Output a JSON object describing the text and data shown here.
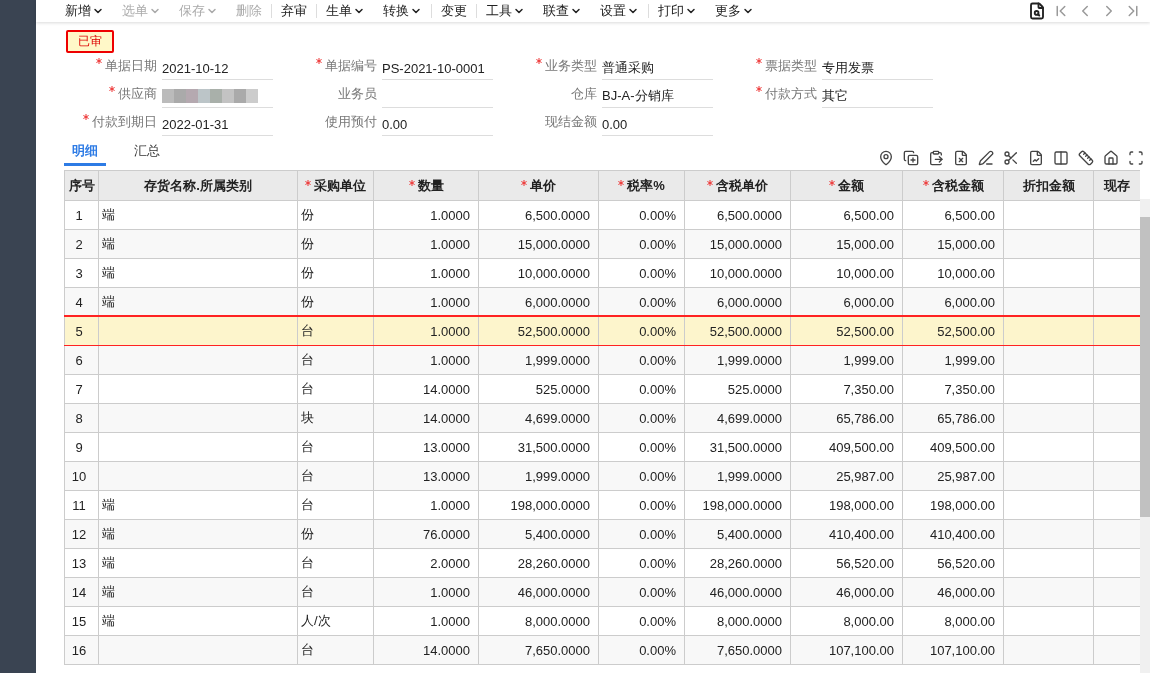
{
  "toolbar": [
    {
      "label": "新增",
      "caret": true,
      "disabled": false
    },
    {
      "label": "选单",
      "caret": true,
      "disabled": true
    },
    {
      "label": "保存",
      "caret": true,
      "disabled": true
    },
    {
      "label": "删除",
      "caret": false,
      "disabled": true,
      "divider": true
    },
    {
      "label": "弃审",
      "caret": false,
      "disabled": false,
      "divider": true
    },
    {
      "label": "生单",
      "caret": true,
      "disabled": false
    },
    {
      "label": "转换",
      "caret": true,
      "disabled": false,
      "divider": true
    },
    {
      "label": "变更",
      "caret": false,
      "disabled": false,
      "divider": true
    },
    {
      "label": "工具",
      "caret": true,
      "disabled": false
    },
    {
      "label": "联查",
      "caret": true,
      "disabled": false
    },
    {
      "label": "设置",
      "caret": true,
      "disabled": false,
      "divider": true
    },
    {
      "label": "打印",
      "caret": true,
      "disabled": false
    },
    {
      "label": "更多",
      "caret": true,
      "disabled": false
    }
  ],
  "status": "已审",
  "form": [
    [
      {
        "label": "单据日期",
        "required": true,
        "value": "2021-10-12"
      },
      {
        "label": "单据编号",
        "required": true,
        "value": "PS-2021-10-0001"
      },
      {
        "label": "业务类型",
        "required": true,
        "value": "普通采购"
      },
      {
        "label": "票据类型",
        "required": true,
        "value": "专用发票"
      }
    ],
    [
      {
        "label": "供应商",
        "required": true,
        "kind": "redacted"
      },
      {
        "label": "业务员",
        "required": false
      },
      {
        "label": "仓库",
        "required": false,
        "value": "BJ-A-分销库"
      },
      {
        "label": "付款方式",
        "required": true,
        "value": "其它"
      }
    ],
    [
      {
        "label": "付款到期日",
        "required": true,
        "value": "2022-01-31"
      },
      {
        "label": "使用预付",
        "required": false,
        "value": "0.00"
      },
      {
        "label": "现结金额",
        "required": false,
        "value": "0.00"
      }
    ]
  ],
  "tabs": [
    {
      "label": "明细",
      "selected": true
    },
    {
      "label": "汇总",
      "selected": false
    }
  ],
  "table": {
    "columns": [
      {
        "label": "序号",
        "required": false
      },
      {
        "label": "存货名称.所属类别",
        "required": false
      },
      {
        "label": "采购单位",
        "required": true
      },
      {
        "label": "数量",
        "required": true
      },
      {
        "label": "单价",
        "required": true
      },
      {
        "label": "税率%",
        "required": true
      },
      {
        "label": "含税单价",
        "required": true
      },
      {
        "label": "金额",
        "required": true
      },
      {
        "label": "含税金额",
        "required": true
      },
      {
        "label": "折扣金额",
        "required": false
      },
      {
        "label": "现存",
        "required": false
      }
    ],
    "rows": [
      {
        "selected": false,
        "cells": [
          "1",
          "端",
          "份",
          "1.0000",
          "6,500.0000",
          "0.00%",
          "6,500.0000",
          "6,500.00",
          "6,500.00"
        ]
      },
      {
        "selected": false,
        "cells": [
          "2",
          "端",
          "份",
          "1.0000",
          "15,000.0000",
          "0.00%",
          "15,000.0000",
          "15,000.00",
          "15,000.00"
        ]
      },
      {
        "selected": false,
        "cells": [
          "3",
          "端",
          "份",
          "1.0000",
          "10,000.0000",
          "0.00%",
          "10,000.0000",
          "10,000.00",
          "10,000.00"
        ]
      },
      {
        "selected": false,
        "cells": [
          "4",
          "端",
          "份",
          "1.0000",
          "6,000.0000",
          "0.00%",
          "6,000.0000",
          "6,000.00",
          "6,000.00"
        ]
      },
      {
        "selected": true,
        "cells": [
          "5",
          "",
          "台",
          "1.0000",
          "52,500.0000",
          "0.00%",
          "52,500.0000",
          "52,500.00",
          "52,500.00"
        ]
      },
      {
        "selected": false,
        "cells": [
          "6",
          "",
          "台",
          "1.0000",
          "1,999.0000",
          "0.00%",
          "1,999.0000",
          "1,999.00",
          "1,999.00"
        ]
      },
      {
        "selected": false,
        "cells": [
          "7",
          "",
          "台",
          "14.0000",
          "525.0000",
          "0.00%",
          "525.0000",
          "7,350.00",
          "7,350.00"
        ]
      },
      {
        "selected": false,
        "cells": [
          "8",
          "",
          "块",
          "14.0000",
          "4,699.0000",
          "0.00%",
          "4,699.0000",
          "65,786.00",
          "65,786.00"
        ]
      },
      {
        "selected": false,
        "cells": [
          "9",
          "",
          "台",
          "13.0000",
          "31,500.0000",
          "0.00%",
          "31,500.0000",
          "409,500.00",
          "409,500.00"
        ]
      },
      {
        "selected": false,
        "cells": [
          "10",
          "",
          "台",
          "13.0000",
          "1,999.0000",
          "0.00%",
          "1,999.0000",
          "25,987.00",
          "25,987.00"
        ]
      },
      {
        "selected": false,
        "cells": [
          "11",
          "端",
          "台",
          "1.0000",
          "198,000.0000",
          "0.00%",
          "198,000.0000",
          "198,000.00",
          "198,000.00"
        ]
      },
      {
        "selected": false,
        "cells": [
          "12",
          "端",
          "份",
          "76.0000",
          "5,400.0000",
          "0.00%",
          "5,400.0000",
          "410,400.00",
          "410,400.00"
        ]
      },
      {
        "selected": false,
        "cells": [
          "13",
          "端",
          "台",
          "2.0000",
          "28,260.0000",
          "0.00%",
          "28,260.0000",
          "56,520.00",
          "56,520.00"
        ]
      },
      {
        "selected": false,
        "cells": [
          "14",
          "端",
          "台",
          "1.0000",
          "46,000.0000",
          "0.00%",
          "46,000.0000",
          "46,000.00",
          "46,000.00"
        ]
      },
      {
        "selected": false,
        "cells": [
          "15",
          "端",
          "人/次",
          "1.0000",
          "8,000.0000",
          "0.00%",
          "8,000.0000",
          "8,000.00",
          "8,000.00"
        ]
      },
      {
        "selected": false,
        "cells": [
          "16",
          "",
          "台",
          "14.0000",
          "7,650.0000",
          "0.00%",
          "7,650.0000",
          "107,100.00",
          "107,100.00"
        ]
      }
    ]
  }
}
